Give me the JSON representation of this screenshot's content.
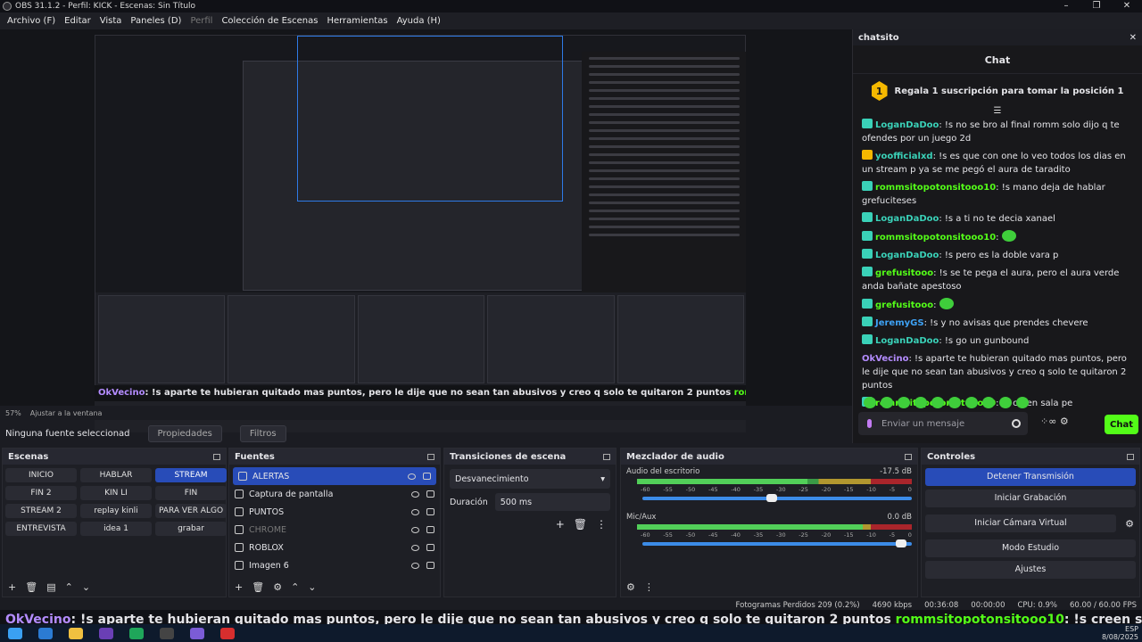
{
  "window": {
    "title": "OBS 31.1.2 - Perfil: KICK - Escenas: Sin Título",
    "controls": [
      "–",
      "❐",
      "✕"
    ]
  },
  "menu": [
    "Archivo (F)",
    "Editar",
    "Vista",
    "Paneles (D)",
    "Perfil",
    "Colección de Escenas",
    "Herramientas",
    "Ayuda (H)"
  ],
  "preview": {
    "zoom": "57%",
    "fit_label": "Ajustar a la ventana",
    "no_source": "Ninguna fuente seleccionad",
    "properties": "Propiedades",
    "filters": "Filtros"
  },
  "chat": {
    "dock_title": "chatsito",
    "title": "Chat",
    "promo": "Regala 1 suscripción para tomar la posición 1",
    "promo_rank": "1",
    "messages": [
      {
        "user": "LoganDaDoo",
        "text": ": !s no se bro al final romm solo dijo q te ofendes por un juego 2d",
        "color": "#3ad1b8"
      },
      {
        "user": "yoofficialxd",
        "text": ": !s es que con one lo veo todos los dias en un stream p ya se me pegó el aura de taradito",
        "color": "#3ad1b8"
      },
      {
        "user": "rommsitopotonsitooo10",
        "text": ": !s mano deja de hablar grefuciteses",
        "color": "#53fc18"
      },
      {
        "user": "LoganDaDoo",
        "text": ": !s a ti no te decia xanael",
        "color": "#3ad1b8"
      },
      {
        "user": "rommsitopotonsitooo10",
        "text": ":",
        "color": "#53fc18"
      },
      {
        "user": "LoganDaDoo",
        "text": ": !s pero es la doble vara p",
        "color": "#3ad1b8"
      },
      {
        "user": "grefusitooo",
        "text": ": !s se te pega el aura, pero el aura verde anda bañate apestoso",
        "color": "#53fc18"
      },
      {
        "user": "grefusitooo",
        "text": ":",
        "color": "#53fc18"
      },
      {
        "user": "JeremyGS",
        "text": ": !s y no avisas que prendes chevere",
        "color": "#3ea2f5"
      },
      {
        "user": "LoganDaDoo",
        "text": ": !s go un gunbound",
        "color": "#3ad1b8"
      },
      {
        "user": "OkVecino",
        "text": ": !s aparte te hubieran quitado mas puntos, pero le dije que no sean tan abusivos y creo q solo te quitaron 2 puntos",
        "color": "#b48cff"
      },
      {
        "user": "rommsitopotonsitooo10",
        "text": ": !s creen sala pe",
        "color": "#53fc18"
      }
    ],
    "input_placeholder": "Enviar un mensaje",
    "send": "Chat",
    "tools": "⁘∞  ⚙"
  },
  "scenes": {
    "title": "Escenas",
    "items": [
      [
        "INICIO",
        "HABLAR",
        "STREAM"
      ],
      [
        "FIN 2",
        "KIN LI",
        "FIN"
      ],
      [
        "STREAM 2",
        "replay kinli",
        "PARA VER ALGO"
      ],
      [
        "ENTREVISTA",
        "idea 1",
        "grabar"
      ]
    ],
    "active": "STREAM"
  },
  "sources": {
    "title": "Fuentes",
    "items": [
      "ALERTAS",
      "Captura de pantalla",
      "PUNTOS",
      "CHROME",
      "ROBLOX",
      "Imagen 6"
    ]
  },
  "transitions": {
    "title": "Transiciones de escena",
    "selected": "Desvanecimiento",
    "duration_label": "Duración",
    "duration": "500 ms"
  },
  "mixer": {
    "title": "Mezclador de audio",
    "channels": [
      {
        "name": "Audio del escritorio",
        "db": "-17.5 dB",
        "level": 0.62,
        "volume": 0.5
      },
      {
        "name": "Mic/Aux",
        "db": "0.0 dB",
        "level": 0.82,
        "volume": 0.98
      }
    ],
    "ticks": [
      "-60",
      "-55",
      "-50",
      "-45",
      "-40",
      "-35",
      "-30",
      "-25",
      "-20",
      "-15",
      "-10",
      "-5",
      "0"
    ]
  },
  "controls": {
    "title": "Controles",
    "buttons": [
      "Detener Transmisión",
      "Iniciar Grabación",
      "Iniciar Cámara Virtual",
      "Modo Estudio",
      "Ajustes"
    ]
  },
  "status": {
    "dropped": "Fotogramas Perdidos 209 (0.2%)",
    "bitrate": "4690 kbps",
    "stream_time": "00:36:08",
    "rec_time": "00:00:00",
    "cpu": "CPU: 0.9%",
    "fps": "60.00 / 60.00 FPS"
  },
  "ticker": {
    "user1": "OkVecino",
    "text1": ": !s aparte te hubieran quitado mas puntos, pero le dije que no sean tan abusivos y creo q solo te quitaron 2 puntos",
    "user2": "rommsitopotonsitooo10",
    "text2": ": !s creen sala pe"
  },
  "taskbar": {
    "lang": "ESP",
    "date": "8/08/2025"
  },
  "colors": {
    "accent": "#284cb8",
    "kick_green": "#53fc18"
  }
}
